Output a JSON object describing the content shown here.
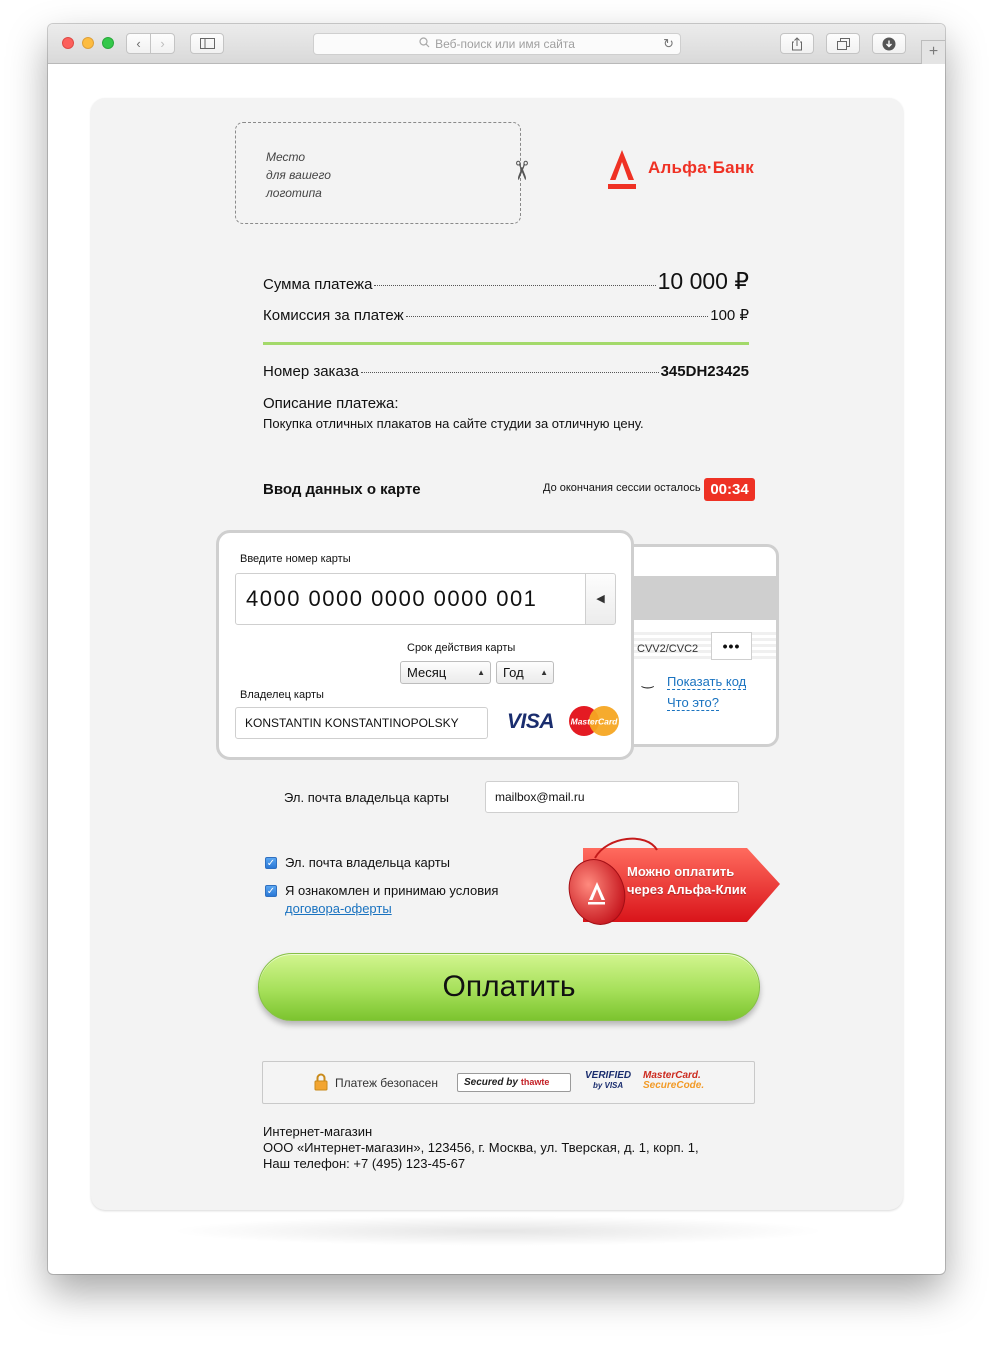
{
  "browser": {
    "address_placeholder": "Веб-поиск или имя сайта"
  },
  "merchant": {
    "logo_placeholder_line1": "Место",
    "logo_placeholder_line2": "для вашего",
    "logo_placeholder_line3": "логотипа"
  },
  "bank": {
    "name": "Альфа·Банк",
    "brand_color": "#ef3124"
  },
  "payment": {
    "sum_label": "Сумма платежа",
    "sum_value": "10 000 ₽",
    "fee_label": "Комиссия за платеж",
    "fee_value": "100 ₽",
    "order_label": "Номер заказа",
    "order_value": "345DH23425",
    "description_label": "Описание платежа:",
    "description_text": "Покупка отличных плакатов на сайте студии за отличную цену."
  },
  "card_section": {
    "title": "Ввод данных о карте",
    "session_label": "До окончания сессии осталось",
    "session_timer": "00:34",
    "timer_color": "#ee3124"
  },
  "card_front": {
    "number_label": "Введите номер карты",
    "number_value": "4000 0000 0000 0000 001",
    "expiry_label": "Срок действия карты",
    "month_value": "Месяц",
    "year_value": "Год",
    "holder_label": "Владелец карты",
    "holder_value": "KONSTANTIN KONSTANTINOPOLSKY",
    "visa_label": "VISA",
    "mastercard_label": "MasterCard"
  },
  "card_back": {
    "cvv_label": "CVV2/CVC2",
    "cvv_value": "•••",
    "show_code_link": "Показать код",
    "whats_this_link": "Что это?"
  },
  "email": {
    "label": "Эл. почта владельца карты",
    "value": "mailbox@mail.ru"
  },
  "agreements": {
    "email_checkbox_label": "Эл. почта владельца карты",
    "terms_checkbox_label": "Я ознакомлен и принимаю условия",
    "terms_link": "договора-оферты",
    "email_checked": true,
    "terms_checked": true
  },
  "alfa_click": {
    "line1": "Можно оплатить",
    "line2": "через Альфа-Клик"
  },
  "pay_button": {
    "label": "Оплатить",
    "color": "#a6e05a"
  },
  "security": {
    "safe_label": "Платеж безопасен",
    "thawte_label": "Secured by",
    "thawte_brand": "thawte",
    "vbv_line1": "VERIFIED",
    "vbv_line2": "by VISA",
    "mcsc_line1": "MasterCard.",
    "mcsc_line2": "SecureCode."
  },
  "footer": {
    "line1": "Интернет-магазин",
    "line2": "ООО «Интернет-магазин», 123456, г. Москва, ул. Тверская, д. 1, корп. 1,",
    "line3": "Наш телефон: +7 (495) 123-45-67"
  }
}
